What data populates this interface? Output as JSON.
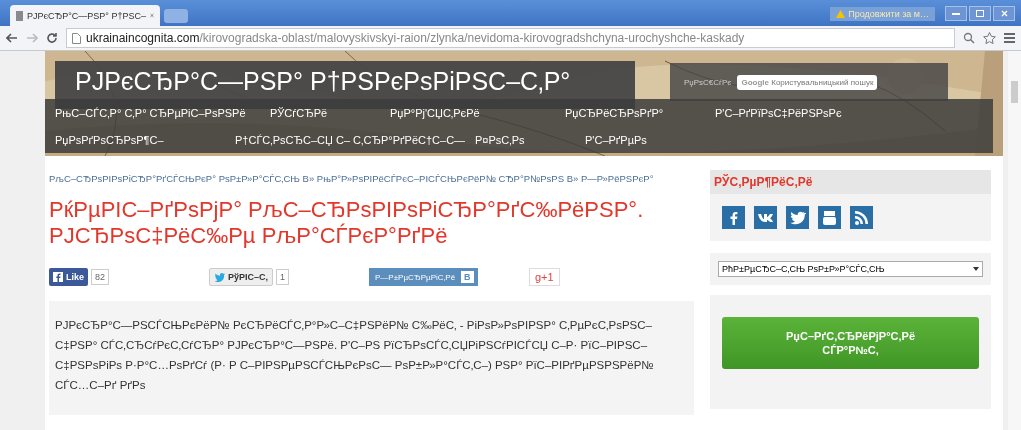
{
  "browser": {
    "tab_title": "РЈРєСЂР°С—РЅР° Р†РЅС–",
    "warning": "Продовжити за м…",
    "url_host": "ukrainaincognita.com",
    "url_path": "/kirovogradska-oblast/malovyskivskyi-raion/zlynka/nevidoma-kirovogradshchyna-urochyshche-kaskady"
  },
  "header": {
    "site_title": "РЈРєСЂР°С—РЅР° Р†РЅРєРѕРіРЅС–С‚Р°",
    "search_label": "РџРѕС€СѓРє",
    "search_brand": "Google",
    "search_placeholder": "Користувальницький пошук",
    "nav_rows": [
      [
        "РњС–СЃС‚Р° С‚Р° СЂРµРіС–РѕРЅРё",
        "РЎСѓСЂРё",
        "РџР°Рј'СЏС‚РєРё",
        "РџСЂРёСЂРѕРґР°",
        "Р'С–РґРїРѕС‡РёРЅРѕРє"
      ],
      [
        "РџРѕРґРѕСЂРѕР¶С–",
        "Р†СЃС‚РѕСЂС–СЏ С– С‚СЂР°РґРёС†С–С—",
        "Р¤РѕС‚Рѕ",
        "Р'С–РґРµРѕ"
      ]
    ]
  },
  "breadcrumb": "РљС–СЂРѕРІРѕРіСЂР°РґСЃСЊРєР° РѕР±Р»Р°СЃС‚СЊ В» РњР°Р»РѕРІРёСЃРєС–РІСЃСЊРєРёР№ СЂР°Р№РѕРЅ В» Р—Р»РёРЅРєР°",
  "article": {
    "title": "РќРµРІС–РґРѕРјР° РљС–СЂРѕРІРѕРіСЂР°РґС‰РёРЅР°. РЈСЂРѕС‡РёС‰Рµ РљР°СЃРєР°РґРё",
    "share": [
      {
        "kind": "like",
        "label": "Like",
        "count": "82"
      },
      {
        "kind": "tweet",
        "label": "РўРІС–С‚",
        "count": "1"
      },
      {
        "kind": "save",
        "label": "Р—Р±РµСЂРµРіС‚Рё",
        "badge": "В"
      },
      {
        "kind": "gplus",
        "label": "g+1"
      }
    ],
    "body": "РЈРєСЂР°С—РЅСЃСЊРєРёР№ РєСЂРёСЃС‚Р°Р»С–С‡РЅРёР№ С‰РёС‚ - РіРѕР»РѕРІРЅР° С‚РµРєС‚РѕРЅС–С‡РЅР° СЃС‚СЂСѓРєС‚СѓСЂР° РЈРєСЂР°С—РЅРё. Р'С–РЅ РїСЂРѕСЃС‚СЏРіРЅСѓРІСЃСЏ С–Р· РїС–РІРЅС–С‡РЅРѕРіРѕ Р·Р°С…РѕРґСѓ (Р· Р С–РІРЅРµРЅСЃСЊРєРѕС— РѕР±Р»Р°СЃС‚С–) РЅР° РїС–РІРґРµРЅРЅРёР№ СЃС…С–Рґ РґРѕ"
  },
  "sidebar": {
    "follow_title": "РЎС‚РµР¶РёС‚Рё",
    "region_select": "РћР±РµСЂС–С‚СЊ РѕР±Р»Р°СЃС‚СЊ",
    "donate_button": "РџС–РґС‚СЂРёРјР°С‚Рё СЃР°Р№С‚"
  }
}
